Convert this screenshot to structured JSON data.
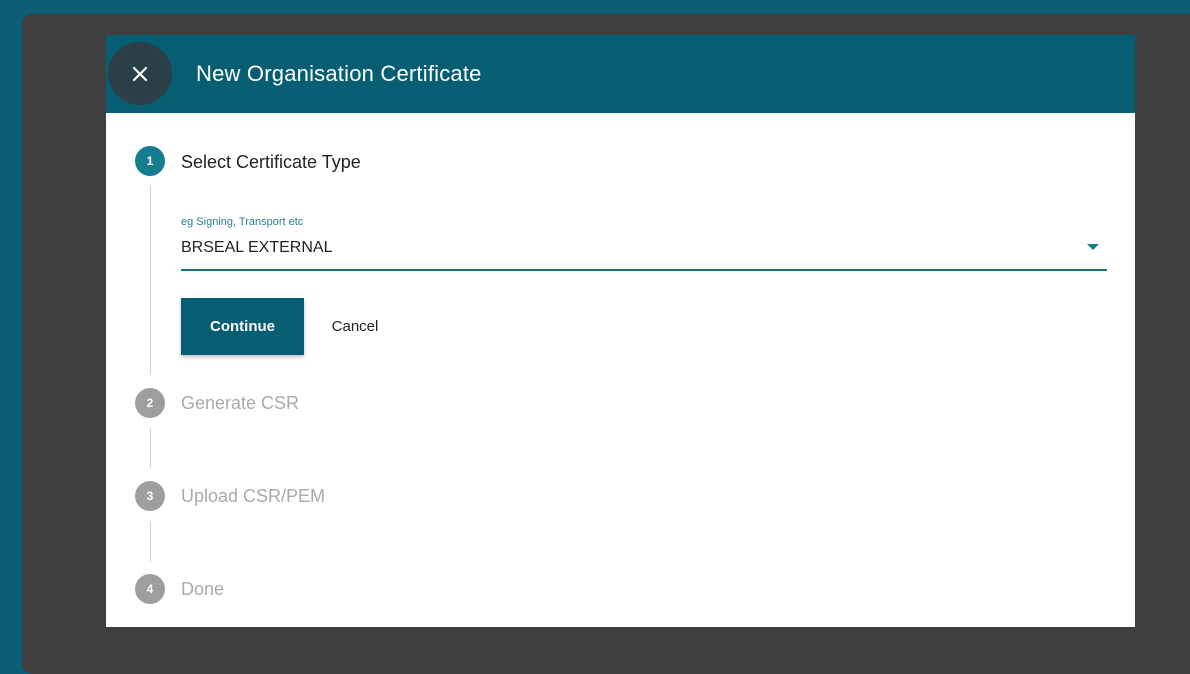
{
  "dialog": {
    "title": "New Organisation Certificate",
    "close_icon": "close-icon"
  },
  "steps": [
    {
      "number": "1",
      "label": "Select Certificate Type",
      "state": "active"
    },
    {
      "number": "2",
      "label": "Generate CSR",
      "state": "inactive"
    },
    {
      "number": "3",
      "label": "Upload CSR/PEM",
      "state": "inactive"
    },
    {
      "number": "4",
      "label": "Done",
      "state": "inactive"
    }
  ],
  "certificate_type": {
    "hint": "eg Signing, Transport etc",
    "value": "BRSEAL EXTERNAL"
  },
  "actions": {
    "continue_label": "Continue",
    "cancel_label": "Cancel"
  },
  "colors": {
    "header": "#075e73",
    "active_step": "#167d91",
    "inactive_step": "#9e9e9e"
  }
}
